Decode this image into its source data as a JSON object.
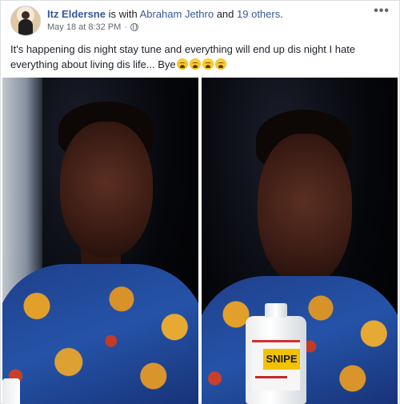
{
  "post": {
    "author": "Itz Eldersne",
    "with_text": " is with ",
    "tagged_person": "Abraham Jethro",
    "and_text": " and ",
    "others": "19 others",
    "end_punct": ".",
    "timestamp": "May 18 at 8:32 PM",
    "meta_sep": "·",
    "privacy_icon": "globe-icon",
    "more_label": "•••",
    "text": "It's happening dis night stay tune and everything will end up dis night I hate everything about living dis life... Bye",
    "emojis": [
      "crying-face-icon",
      "crying-face-icon",
      "crying-face-icon",
      "crying-face-icon"
    ]
  },
  "photos": {
    "right_bottle_label": "SNIPE"
  },
  "colors": {
    "link": "#365899",
    "meta": "#616770",
    "text": "#1d2129",
    "border": "#dddfe2"
  }
}
